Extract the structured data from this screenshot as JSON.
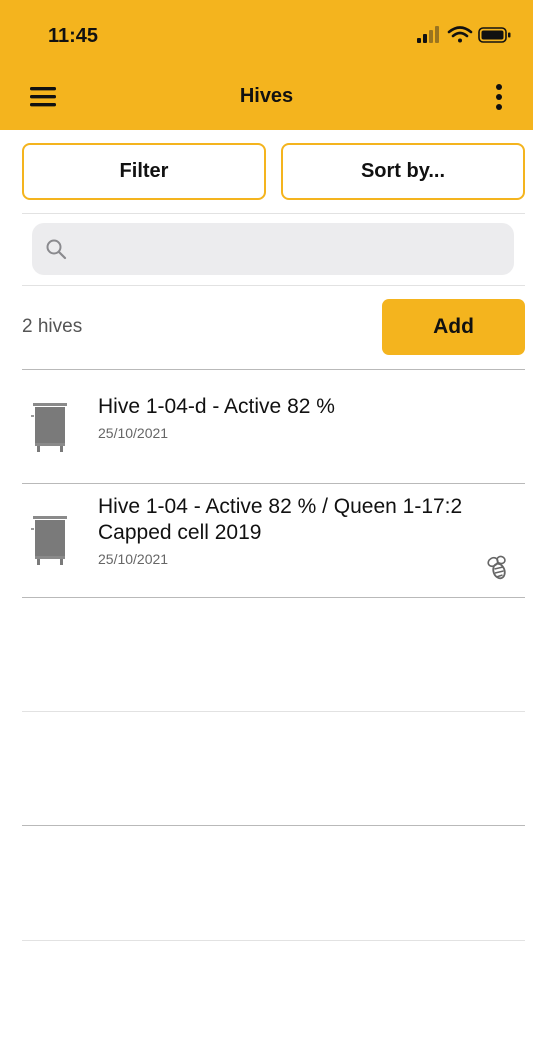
{
  "status_bar": {
    "time": "11:45"
  },
  "nav": {
    "title": "Hives"
  },
  "toolbar": {
    "filter_label": "Filter",
    "sort_label": "Sort by..."
  },
  "search": {
    "placeholder": "",
    "value": ""
  },
  "summary": {
    "count_text": "2 hives",
    "add_label": "Add"
  },
  "hives": [
    {
      "title": "Hive 1-04-d - Active 82 %",
      "date": "25/10/2021",
      "has_queen_icon": false
    },
    {
      "title": "Hive 1-04 - Active 82 %  / Queen 1-17:2 Capped cell 2019",
      "date": "25/10/2021",
      "has_queen_icon": true
    }
  ],
  "colors": {
    "accent": "#F4B41E",
    "icon_gray": "#7a7a7a"
  },
  "icons": [
    "hamburger-menu-icon",
    "more-vertical-icon",
    "search-icon",
    "hive-box-icon",
    "bee-icon",
    "signal-icon",
    "wifi-icon",
    "battery-icon"
  ]
}
